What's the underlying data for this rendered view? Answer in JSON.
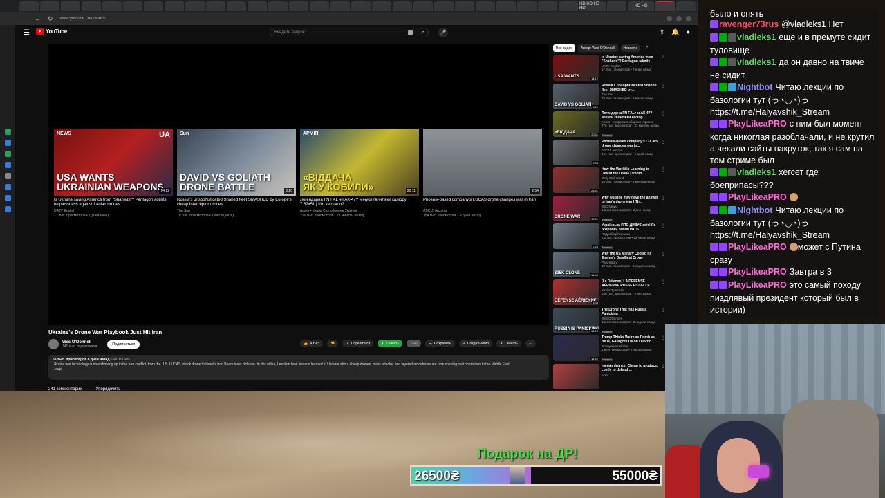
{
  "browser": {
    "url": "www.youtube.com/watch",
    "hd_tabs": [
      "HD HD HD HD",
      "HD HD"
    ]
  },
  "youtube": {
    "logo_text": "YouTube",
    "search_placeholder": "Введите запрос",
    "endscreen": [
      {
        "title": "Is Ukraine saving America from \"Shaheds\"? Pentagon admits helplessness against Iranian drones",
        "channel": "UATV English",
        "meta": "17 тыс. просмотров • 7 дней назад",
        "duration": "14:12",
        "caption": "USA WANTS\nUKRAINIAN WEAPONS",
        "badge": "NEWS",
        "corner": "UA"
      },
      {
        "title": "Russia's unsophisticated Shahed fleet SMASHED by Europe's cheap interceptor drones",
        "channel": "The Sun",
        "meta": "78 тыс. просмотров • 1 месяц назад",
        "duration": "8:20",
        "caption": "DAVID VS GOLIATH\nDRONE BATTLE",
        "badge": "Sun"
      },
      {
        "title": "Легендарна FN FAL чи АК-47? Мінуси гвинтівки калібру 7.62x51 | Що за ствол?",
        "channel": "Армія • Медіа Сил оборони України",
        "meta": "276 тыс. просмотров • 23 минуты назад",
        "duration": "20:11",
        "caption": "«ВІДДАЧА\nЯК У КОБИЛИ»",
        "badge": "АРМІЯ"
      },
      {
        "title": "Phoenix-based company's LUCAS drone changes war in Iran",
        "channel": "ABC15 Arizona",
        "meta": "154 тыс. просмотров • 9 дней назад",
        "duration": "2:54",
        "caption": ""
      }
    ],
    "video": {
      "title": "Ukraine's Drone War Playbook Just Hit Iran",
      "owner": "Wes O'Donnell",
      "subs": "141 тыс. подписчиков",
      "subscribe": "Подписаться",
      "likes": "4 тыс.",
      "share": "Поделиться",
      "download": "Скачать",
      "quality": "1440",
      "save": "Сохранить",
      "clip": "Создать клип",
      "download2": "Скачать",
      "desc_meta": "63 тыс. просмотров  8 дней назад",
      "desc_tag": "#MICHIGAN",
      "description": "Ukraine war technology is now showing up in the Iran conflict, from the U.S. LUCAS attack drone to Israel's Iron Beam laser defense. In this video, I explain how lessons learned in Ukraine about cheap drones, mass attacks, and layered air defense are now shaping real operations in the Middle East.",
      "more": "...ещё",
      "comments": "241 комментарий",
      "sort": "Упорядочить"
    },
    "chips": [
      "Все видео",
      "Автор: Wes O'Donnell",
      "Новости"
    ],
    "recommendations": [
      {
        "title": "Is Ukraine saving America from \"Shaheds\"? Pentagon admits...",
        "channel": "UATV English",
        "meta": "17 тыс. просмотров • 7 дней назад",
        "duration": "14:12",
        "cap": "USA WANTS",
        "color": "#7a1010"
      },
      {
        "title": "Russia's unsophisticated Shahed fleet SMASHED by...",
        "channel": "The Sun",
        "meta": "78 тыс. просмотров • 1 месяц назад",
        "duration": "8:20",
        "cap": "DAVID VS GOLIATH",
        "color": "#56606c"
      },
      {
        "title": "Легендарна FN FAL чи АК-47? Мінуси гвинтівки калібр...",
        "channel": "Армія • Медіа Сил оборони України",
        "meta": "276 тыс. просмотров • 23 минуты назад",
        "duration": "20:11",
        "cap": "«ВІДДАЧА",
        "color": "#6a6a20",
        "badge": "Новинка"
      },
      {
        "title": "Phoenix-based company's LUCAS drone changes war in...",
        "channel": "ABC15 Arizona",
        "meta": "154 тыс. просмотров • 9 дней назад",
        "duration": "2:54",
        "cap": "",
        "color": "#6a6e74"
      },
      {
        "title": "How the World is Learning to Defeat the Drone | Photo...",
        "channel": "Daily Mail World",
        "meta": "10 тыс. просмотров • 2 месяца назад",
        "duration": "26:41",
        "cap": "",
        "color": "#903030"
      },
      {
        "title": "Why Ukraine may have the answer to Iran's drone war | Th...",
        "channel": "BBC News",
        "meta": "1,1 млн просмотров • 2 дня назад",
        "duration": "10:01",
        "cap": "DRONE WAR",
        "color": "#a02040",
        "badge": "Новинка"
      },
      {
        "title": "Українська ППО ДИВУЄ світ! Як розробки ЗМІНЮЮТЬ...",
        "channel": "Подробиці Полонки",
        "meta": "2,2 тыс. просмотров • 13 часов назад",
        "duration": "7:28",
        "cap": "",
        "color": "#6a7a88",
        "badge": "Новинка"
      },
      {
        "title": "Why the US Military Copied Its Enemy's Deadliest Drone",
        "channel": "PlusHistory",
        "meta": "30 тыс. просмотров • 2 недели назад",
        "duration": "14:46",
        "cap": "$35K CLONE",
        "color": "#607080"
      },
      {
        "title": "[Le Défense] LA DÉFENSE AÉRIENNE RUSSE EST-ELLE...",
        "channel": "Xavier Tytelman",
        "meta": "260 тыс. просмотров • 3 дня назад",
        "duration": "6:33",
        "cap": "DÉFENSE AÉRIENNE",
        "color": "#b03030"
      },
      {
        "title": "The Drone That Has Russia Panicking",
        "channel": "Wes O'Donnell",
        "meta": "1,1 млн просмотров • 2 недели назад",
        "duration": "14:28",
        "cap": "RUSSIA IS PANICKING",
        "color": "#3a4a5a",
        "badge": "Новинка"
      },
      {
        "title": "Trump Thinks We're as Dumb as He Is, Gaslights Us on Oil Pric...",
        "channel": "Jimmy Kimmel Live",
        "meta": "1 млн просмотров • 5 часов назад",
        "duration": "14:52",
        "cap": "",
        "color": "#2a2a50",
        "badge": "Новинка"
      },
      {
        "title": "Iranian drones: Cheap to produce, costly to defend ...",
        "channel": "CNN",
        "meta": "",
        "duration": "",
        "cap": "",
        "color": "#b04040"
      }
    ]
  },
  "stream": {
    "gift_title": "Подарок на ДР!",
    "goal_current": "26500₴",
    "goal_target": "55000₴",
    "goal_progress": 0.48
  },
  "chat": {
    "top": "было и опять",
    "messages": [
      {
        "nick": "ravenger73rus",
        "text": "@vladleks1 Нет",
        "color": "n-red",
        "badges": [
          "b-sub"
        ]
      },
      {
        "nick": "vladleks1",
        "text": "еще и в премуте сидит туловище",
        "color": "n-green",
        "badges": [
          "b-sub",
          "b-mod",
          "b-bot"
        ]
      },
      {
        "nick": "vladleks1",
        "text": "да он давно на твиче не сидит",
        "color": "n-green",
        "badges": [
          "b-sub",
          "b-mod",
          "b-bot"
        ]
      },
      {
        "nick": "Nightbot",
        "text": "Читаю лекции по базологии тут (っ◔◡◔)っ https://t.me/Halyavshik_Stream",
        "color": "n-blue",
        "badges": [
          "b-sub",
          "b-mod",
          "b-gift"
        ]
      },
      {
        "nick": "PlayLikeaPRO",
        "text": "с ним был момент когда никоглая разоблачали, и не крутил а чекали сайты накруток, так я сам на том стриме был",
        "color": "n-pink",
        "badges": [
          "b-sub",
          "b-sub"
        ]
      },
      {
        "nick": "vladleks1",
        "text": "хегсет где боеприпасы???",
        "color": "n-green",
        "badges": [
          "b-sub",
          "b-mod",
          "b-bot"
        ]
      },
      {
        "nick": "PlayLikeaPRO",
        "text": "",
        "color": "n-pink",
        "badges": [
          "b-sub",
          "b-sub"
        ],
        "emoji": true
      },
      {
        "nick": "Nightbot",
        "text": "Читаю лекции по базологии тут (っ◔◡◔)っ https://t.me/Halyavshik_Stream",
        "color": "n-blue",
        "badges": [
          "b-sub",
          "b-mod",
          "b-gift"
        ]
      },
      {
        "nick": "PlayLikeaPRO",
        "text": "может с Путина сразу",
        "color": "n-pink",
        "badges": [
          "b-sub",
          "b-sub"
        ],
        "emoji": true
      },
      {
        "nick": "PlayLikeaPRO",
        "text": "Завтра в 3",
        "color": "n-pink",
        "badges": [
          "b-sub",
          "b-sub"
        ]
      },
      {
        "nick": "PlayLikeaPRO",
        "text": "это самый походу пиздлявый президент который был в истории)",
        "color": "n-pink",
        "badges": [
          "b-sub",
          "b-sub"
        ]
      }
    ]
  }
}
